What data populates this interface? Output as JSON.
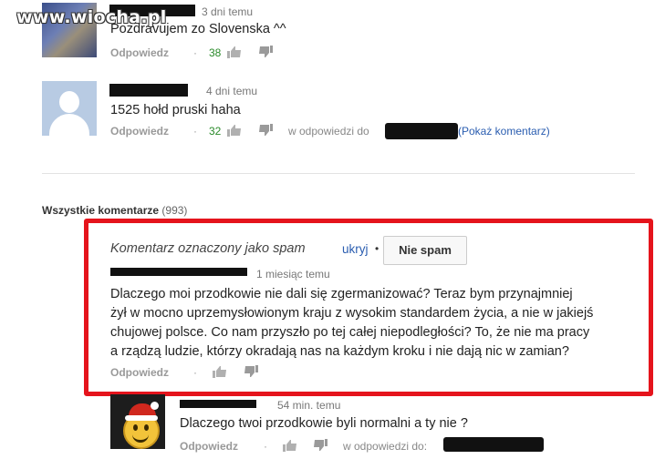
{
  "watermark": "www.wiocha.pl",
  "comments": [
    {
      "time": "3 dni temu",
      "text": "Pozdravujem zo Slovenska ^^",
      "reply_label": "Odpowiedz",
      "separator": "·",
      "likes": "38"
    },
    {
      "time": "4 dni temu",
      "text": "1525 hołd pruski haha",
      "reply_label": "Odpowiedz",
      "separator": "·",
      "likes": "32",
      "in_reply_to": "w odpowiedzi do",
      "show_comment": "(Pokaż komentarz)"
    }
  ],
  "all_comments": {
    "label": "Wszystkie komentarze",
    "count": "(993)"
  },
  "spam_comment": {
    "flag_label": "Komentarz oznaczony jako spam",
    "hide_label": "ukryj",
    "separator": "•",
    "not_spam_label": "Nie spam",
    "time": "1 miesiąc temu",
    "lines": [
      "Dlaczego moi przodkowie nie dali się zgermanizować? Teraz bym przynajmniej",
      "żył w mocno uprzemysłowionym kraju z wysokim standardem życia, a nie w jakiejś",
      "chujowej polsce. Co nam przyszło po tej całej niepodległości? To, że nie ma pracy",
      "a rządzą ludzie, którzy okradają nas na każdym kroku i nie dają nic w zamian?"
    ],
    "reply_label": "Odpowiedz",
    "separator2": "·"
  },
  "reply_comment": {
    "time": "54 min. temu",
    "text": "Dlaczego twoi przodkowie byli normalni a ty nie ?",
    "reply_label": "Odpowiedz",
    "separator": "·",
    "in_reply_to": "w odpowiedzi do:"
  },
  "icons": {
    "like": "thumbs-up-icon",
    "dislike": "thumbs-down-icon"
  },
  "colors": {
    "highlight_border": "#e5141c",
    "likes": "#2a8a2a",
    "link": "#2a5db0"
  }
}
